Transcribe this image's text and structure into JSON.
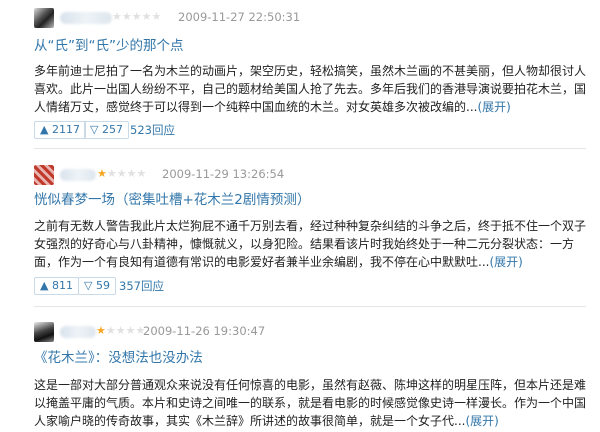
{
  "reviews": [
    {
      "time": "2009-11-27 22:50:31",
      "rating": 0,
      "title": "从“氏”到“氏”少的那个点",
      "body": "多年前迪士尼拍了一名为木兰的动画片，架空历史，轻松搞笑，虽然木兰画的不甚美丽，但人物却很讨人喜欢。此片一出国人纷纷不平，自己的题材给美国人抢了先去。多年后我们的香港导演说要拍花木兰，国人情绪万丈，感觉终于可以得到一个纯粹中国血统的木兰。对女英雄多次被改编的...",
      "expand": "(展开)",
      "useful": "2117",
      "useless": "257",
      "replies": "523回应"
    },
    {
      "time": "2009-11-29 13:26:54",
      "rating": 1,
      "title": "恍似春梦一场（密集吐槽+花木兰2剧情预测）",
      "body": "之前有无数人警告我此片太烂狗屁不通千万别去看，经过种种复杂纠结的斗争之后，终于抵不住一个双子女强烈的好奇心与八卦精神，慷慨就义，以身犯险。结果看该片时我始终处于一种二元分裂状态：一方面，作为一个有良知有道德有常识的电影爱好者兼半业余编剧，我不停在心中默默吐...",
      "expand": "(展开)",
      "useful": "811",
      "useless": "59",
      "replies": "357回应"
    },
    {
      "time": "2009-11-26 19:30:47",
      "rating": 1,
      "title": "《花木兰》：没想法也没办法",
      "body": "这是一部对大部分普通观众来说没有任何惊喜的电影，虽然有赵薇、陈坤这样的明星压阵，但本片还是难以掩盖平庸的气质。本片和史诗之间唯一的联系，就是看电影的时候感觉像史诗一样漫长。作为一个中国人家喻户晓的传奇故事，其实《木兰辞》所讲述的故事很简单，就是一个女子代...",
      "expand": "(展开)"
    }
  ],
  "icons": {
    "useful": "▲",
    "useless": "▽"
  },
  "colors": {
    "link": "#3377aa",
    "star": "#f5a623",
    "meta": "#999999"
  }
}
